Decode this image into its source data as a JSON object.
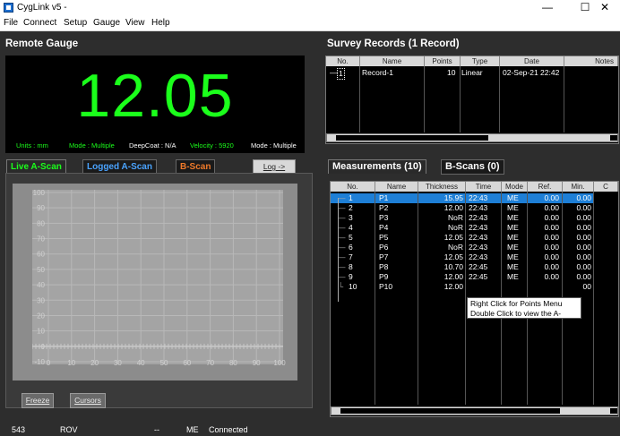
{
  "window": {
    "title": "CygLink v5 -",
    "min": "—",
    "max": "☐",
    "close": "✕"
  },
  "menu": [
    "File",
    "Connect",
    "Setup",
    "Gauge",
    "View",
    "Help"
  ],
  "gauge": {
    "section_title": "Remote Gauge",
    "reading": "12.05",
    "info": {
      "units": "Units : mm",
      "mode": "Mode : Multiple",
      "deepcoat": "DeepCoat : N/A",
      "velocity": "Velocity : 5920",
      "mode2": "Mode : Multiple"
    }
  },
  "scan_tabs": {
    "live": "Live A-Scan",
    "logged": "Logged A-Scan",
    "bscan": "B-Scan"
  },
  "log_button": "Log ->",
  "ascan": {
    "y_ticks": [
      "100",
      "90",
      "80",
      "70",
      "60",
      "50",
      "40",
      "30",
      "20",
      "10",
      "0",
      "-10"
    ],
    "x_ticks": [
      "0",
      "10",
      "20",
      "30",
      "40",
      "50",
      "60",
      "70",
      "80",
      "90",
      "100"
    ]
  },
  "freeze_button": "Freeze",
  "cursors_button": "Cursors",
  "survey": {
    "section_title": "Survey Records (1 Record)",
    "columns": [
      "No.",
      "Name",
      "Points",
      "Type",
      "Date",
      "Notes"
    ],
    "rows": [
      {
        "no": "1",
        "name": "Record-1",
        "points": "10",
        "type": "Linear",
        "date": "02-Sep-21 22:42",
        "notes": ""
      }
    ]
  },
  "meas_tabs": {
    "measurements": "Measurements (10)",
    "bscans": "B-Scans (0)"
  },
  "measurements": {
    "columns": [
      "No.",
      "Name",
      "Thickness",
      "Time",
      "Mode",
      "Ref.",
      "Min.",
      "C"
    ],
    "rows": [
      {
        "no": "1",
        "name": "P1",
        "thickness": "15.95",
        "time": "22:43",
        "mode": "ME",
        "ref": "0.00",
        "min": "0.00"
      },
      {
        "no": "2",
        "name": "P2",
        "thickness": "12.00",
        "time": "22:43",
        "mode": "ME",
        "ref": "0.00",
        "min": "0.00"
      },
      {
        "no": "3",
        "name": "P3",
        "thickness": "NoR",
        "time": "22:43",
        "mode": "ME",
        "ref": "0.00",
        "min": "0.00"
      },
      {
        "no": "4",
        "name": "P4",
        "thickness": "NoR",
        "time": "22:43",
        "mode": "ME",
        "ref": "0.00",
        "min": "0.00"
      },
      {
        "no": "5",
        "name": "P5",
        "thickness": "12.05",
        "time": "22:43",
        "mode": "ME",
        "ref": "0.00",
        "min": "0.00"
      },
      {
        "no": "6",
        "name": "P6",
        "thickness": "NoR",
        "time": "22:43",
        "mode": "ME",
        "ref": "0.00",
        "min": "0.00"
      },
      {
        "no": "7",
        "name": "P7",
        "thickness": "12.05",
        "time": "22:43",
        "mode": "ME",
        "ref": "0.00",
        "min": "0.00"
      },
      {
        "no": "8",
        "name": "P8",
        "thickness": "10.70",
        "time": "22:45",
        "mode": "ME",
        "ref": "0.00",
        "min": "0.00"
      },
      {
        "no": "9",
        "name": "P9",
        "thickness": "12.00",
        "time": "22:45",
        "mode": "ME",
        "ref": "0.00",
        "min": "0.00"
      },
      {
        "no": "10",
        "name": "P10",
        "thickness": "12.00",
        "time": "",
        "mode": "",
        "ref": "",
        "min": "00"
      }
    ],
    "selected_index": 0
  },
  "tooltip": {
    "line1": "Right Click for Points Menu",
    "line2": "Double Click to view the A-Scan"
  },
  "status": {
    "s1": "543",
    "s2": "ROV",
    "s3": "--",
    "s4": "ME",
    "s5": "Connected"
  },
  "colors": {
    "reading": "#1bff1b",
    "live_tab": "#1bff1b",
    "logged_tab": "#4aa3ff",
    "bscan_tab": "#f07a2a",
    "selection": "#1e7fd6"
  }
}
